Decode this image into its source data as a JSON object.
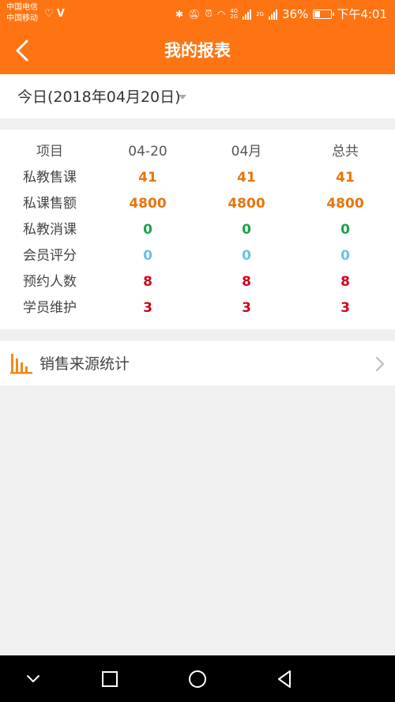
{
  "status_bar": {
    "carrier1": "中国电信",
    "carrier2": "中国移动",
    "network_top": "4G",
    "network_bottom": "2G",
    "network2": "2G",
    "battery_text": "36%",
    "battery_level": 0.36,
    "time": "下午4:01"
  },
  "header": {
    "title": "我的报表"
  },
  "date_filter": {
    "label": "今日(2018年04月20日)"
  },
  "stats": {
    "headers": [
      "项目",
      "04-20",
      "04月",
      "总共"
    ],
    "rows": [
      {
        "label": "私教售课",
        "values": [
          "41",
          "41",
          "41"
        ],
        "color": "#e8750a"
      },
      {
        "label": "私课售额",
        "values": [
          "4800",
          "4800",
          "4800"
        ],
        "color": "#e8750a"
      },
      {
        "label": "私教消课",
        "values": [
          "0",
          "0",
          "0"
        ],
        "color": "#1aa34a"
      },
      {
        "label": "会员评分",
        "values": [
          "0",
          "0",
          "0"
        ],
        "color": "#6cc0ea"
      },
      {
        "label": "预约人数",
        "values": [
          "8",
          "8",
          "8"
        ],
        "color": "#d0021b"
      },
      {
        "label": "学员维护",
        "values": [
          "3",
          "3",
          "3"
        ],
        "color": "#d0021b"
      }
    ]
  },
  "sales_source": {
    "label": "销售来源统计"
  },
  "colors": {
    "brand": "#ff7412"
  }
}
